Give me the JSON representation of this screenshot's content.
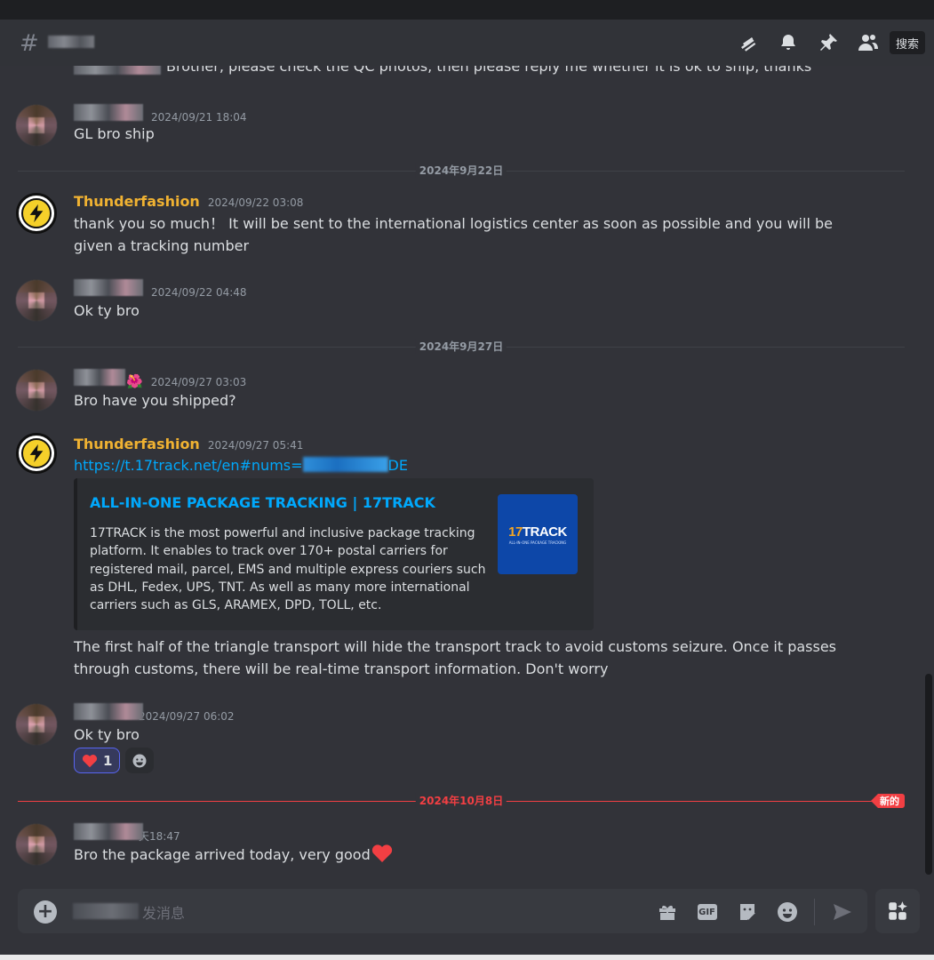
{
  "header": {
    "hash": "#",
    "search_label": "搜索"
  },
  "messages": {
    "partial_text": "Brother, please check the QC photos, then please reply me whether it is ok to ship, thanks",
    "m1": {
      "timestamp": "2024/09/21 18:04",
      "text": "GL bro ship"
    },
    "div1": "2024年9月22日",
    "m2": {
      "username": "Thunderfashion",
      "timestamp": "2024/09/22 03:08",
      "text": "thank you so much！ It will be sent to the international logistics center as soon as possible and you will be given a tracking number"
    },
    "m3": {
      "timestamp": "2024/09/22 04:48",
      "text": "Ok ty bro"
    },
    "div2": "2024年9月27日",
    "m4": {
      "emoji": "🌺",
      "timestamp": "2024/09/27 03:03",
      "text": "Bro have you shipped?"
    },
    "m5": {
      "username": "Thunderfashion",
      "timestamp": "2024/09/27 05:41",
      "link_prefix": "https://t.17track.net/en#nums=",
      "link_suffix": "DE",
      "embed": {
        "title": "ALL-IN-ONE PACKAGE TRACKING | 17TRACK",
        "description": "17TRACK is the most powerful and inclusive package tracking platform. It enables to track over 170+ postal carriers for registered mail, parcel, EMS and multiple express couriers such as DHL, Fedex, UPS, TNT. As well as many more international carriers such as GLS, ARAMEX, DPD, TOLL, etc.",
        "thumb_logo_num": "17",
        "thumb_logo_word": "TRACK",
        "thumb_sub": "ALL-IN-ONE PACKAGE TRACKING"
      },
      "text": "The first half of the triangle transport will hide the transport track to avoid customs seizure. Once it passes through customs, there will be real-time transport information. Don't worry"
    },
    "m6": {
      "timestamp": "2024/09/27 06:02",
      "text": "Ok ty bro",
      "reaction_count": "1"
    },
    "div3": "2024年10月8日",
    "new_tag": "新的",
    "m7": {
      "timestamp": "天18:47",
      "text": "Bro the package arrived today, very good"
    }
  },
  "composer": {
    "placeholder": "发消息",
    "gif_label": "GIF"
  },
  "colors": {
    "bg": "#323339",
    "username": "#f0b232",
    "link": "#00a8fc",
    "new_divider": "#f23f43"
  }
}
